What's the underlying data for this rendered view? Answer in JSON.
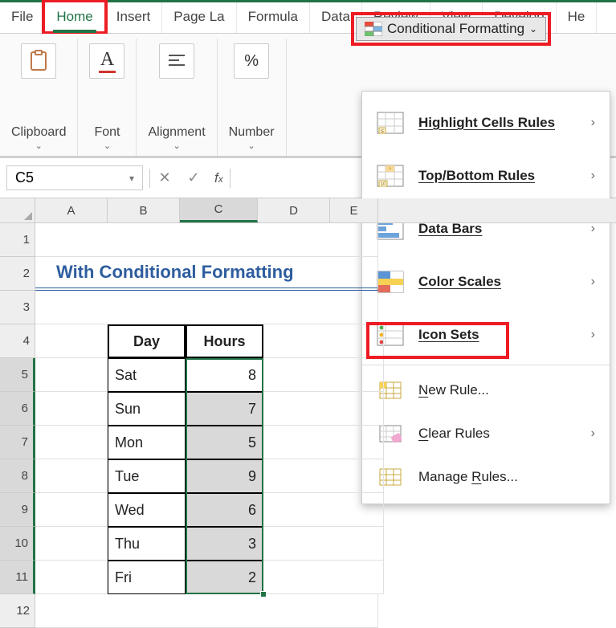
{
  "tabs": {
    "file": "File",
    "home": "Home",
    "insert": "Insert",
    "page": "Page La",
    "formulas": "Formula",
    "data": "Data",
    "review": "Review",
    "view": "View",
    "developer": "Develop",
    "help": "He"
  },
  "ribbon": {
    "clipboard": "Clipboard",
    "font": "Font",
    "alignment": "Alignment",
    "number": "Number"
  },
  "cf": {
    "button": "Conditional Formatting",
    "items": {
      "highlight": "Highlight Cells Rules",
      "topbottom": "Top/Bottom Rules",
      "databars": "Data Bars",
      "colorscales": "Color Scales",
      "iconsets": "Icon Sets",
      "newrule": "New Rule...",
      "clear": "Clear Rules",
      "manage": "Manage Rules..."
    }
  },
  "fx": {
    "namebox": "C5"
  },
  "cols": [
    "A",
    "B",
    "C",
    "D",
    "E"
  ],
  "title": "With Conditional Formatting",
  "headers": {
    "day": "Day",
    "hours": "Hours"
  },
  "data": [
    {
      "day": "Sat",
      "hours": "8"
    },
    {
      "day": "Sun",
      "hours": "7"
    },
    {
      "day": "Mon",
      "hours": "5"
    },
    {
      "day": "Tue",
      "hours": "9"
    },
    {
      "day": "Wed",
      "hours": "6"
    },
    {
      "day": "Thu",
      "hours": "3"
    },
    {
      "day": "Fri",
      "hours": "2"
    }
  ],
  "rownums": [
    "1",
    "2",
    "3",
    "4",
    "5",
    "6",
    "7",
    "8",
    "9",
    "10",
    "11",
    "12"
  ]
}
